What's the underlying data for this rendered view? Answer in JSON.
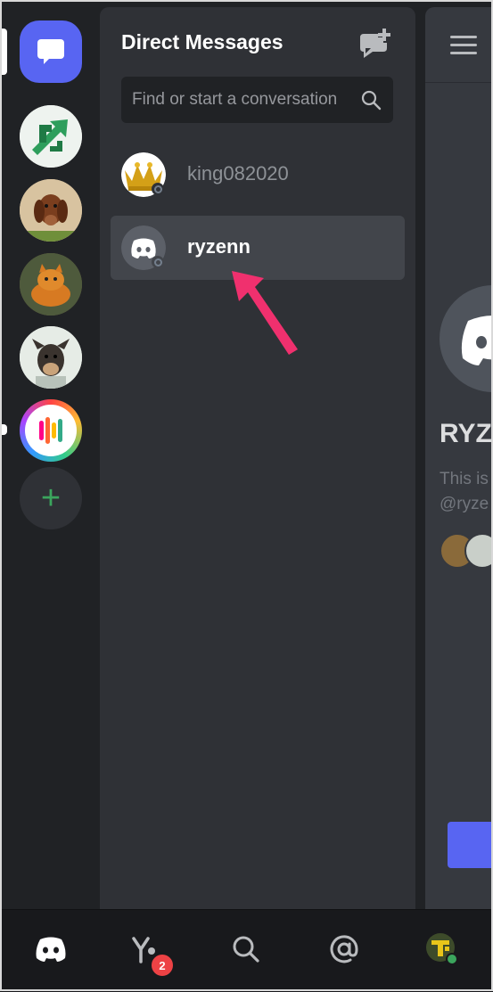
{
  "direct_messages": {
    "title": "Direct Messages",
    "search_placeholder": "Find or start a conversation",
    "conversations": [
      {
        "name": "king082020",
        "status": "offline",
        "avatar": "crown-avatar"
      },
      {
        "name": "ryzenn",
        "status": "offline",
        "avatar": "discord-default-avatar",
        "selected": true
      }
    ]
  },
  "servers": [
    {
      "name": "home",
      "icon": "chat-bubble-icon",
      "selected": true
    },
    {
      "name": "server-green-arrows",
      "icon": "green-arrows-icon"
    },
    {
      "name": "server-dachshund",
      "icon": "dachshund-photo"
    },
    {
      "name": "server-garfield",
      "icon": "garfield-photo"
    },
    {
      "name": "server-dog",
      "icon": "dog-photo"
    },
    {
      "name": "server-soundwave",
      "icon": "soundwave-icon",
      "unread": true
    },
    {
      "name": "add-server",
      "icon": "plus-icon"
    }
  ],
  "chat_preview": {
    "name": "RYZ",
    "description_line1": "This is",
    "description_line2": "@ryze"
  },
  "bottom_nav": {
    "friends_badge": "2",
    "items": [
      "home-icon",
      "friends-icon",
      "search-icon",
      "mentions-icon",
      "profile-avatar"
    ]
  },
  "colors": {
    "blurple": "#5865f2",
    "green": "#3ba55d",
    "red": "#ed4245",
    "arrow": "#f0306e"
  }
}
